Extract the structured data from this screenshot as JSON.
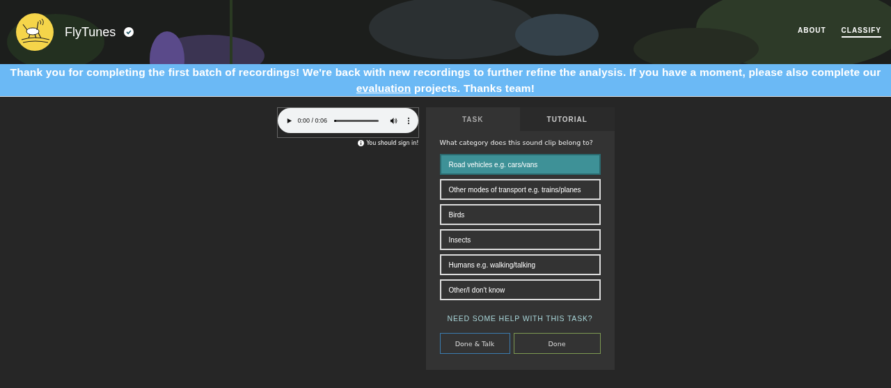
{
  "header": {
    "project_name": "FlyTunes",
    "verified": true,
    "nav": [
      {
        "label": "ABOUT",
        "selected": false
      },
      {
        "label": "CLASSIFY",
        "selected": true
      }
    ]
  },
  "banner": {
    "text": "Thank you for completing the first batch of recordings! We're back with new recordings to further refine the analysis. If you have a moment, please also complete our ",
    "link": "evaluation",
    "after": " projects. Thanks team!"
  },
  "player": {
    "time": "0:00 / 0:06",
    "level": 0,
    "notice": "You should sign in!"
  },
  "task_panel": {
    "tabs": [
      {
        "label": "TASK",
        "selected": true
      },
      {
        "label": "TUTORIAL",
        "selected": false
      }
    ],
    "question": "What category does this sound clip belong to?",
    "answers": [
      {
        "label": "Road vehicles e.g. cars/vans",
        "selected": true
      },
      {
        "label": "Other modes of transport e.g. trains/planes",
        "selected": false
      },
      {
        "label": "Birds",
        "selected": false
      },
      {
        "label": "Insects",
        "selected": false
      },
      {
        "label": "Humans e.g. walking/talking",
        "selected": false
      },
      {
        "label": "Other/I don't know",
        "selected": false
      }
    ],
    "help_link": "NEED SOME HELP WITH THIS TASK?",
    "buttons": [
      {
        "label": "Done & Talk",
        "kind": "talk"
      },
      {
        "label": "Done",
        "kind": "done"
      }
    ]
  }
}
